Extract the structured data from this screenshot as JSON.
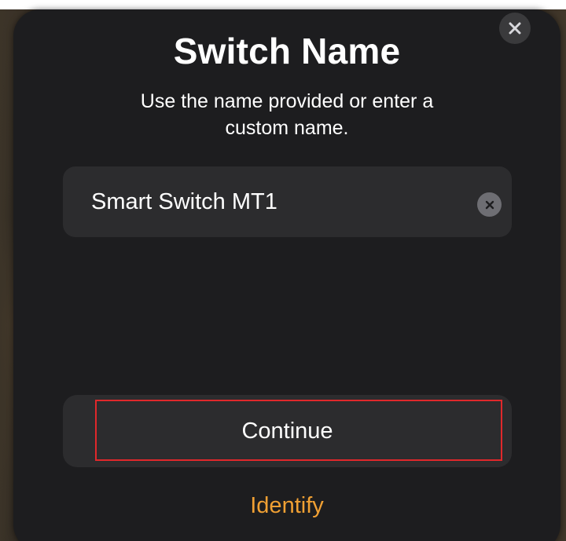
{
  "dialog": {
    "title": "Switch Name",
    "subtitle": "Use the name provided or enter a custom name.",
    "close_icon": "close-icon",
    "name_field": {
      "value": "Smart Switch MT1",
      "placeholder": "",
      "clear_icon": "clear-text-icon"
    },
    "continue_label": "Continue",
    "identify_label": "Identify"
  },
  "colors": {
    "sheet_background": "#1d1d1f",
    "field_background": "#2c2c2e",
    "accent": "#f0a033",
    "highlight_outline": "#e0282b"
  }
}
